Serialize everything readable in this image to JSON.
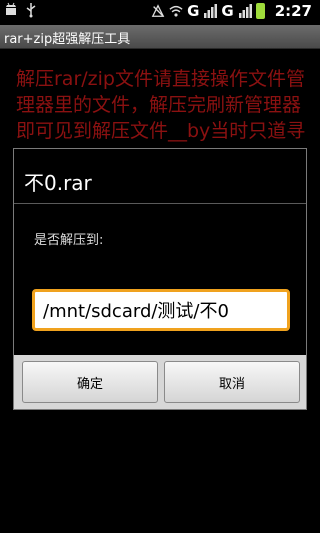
{
  "status_bar": {
    "network_letter_1": "G",
    "network_letter_2": "G",
    "time": "2:27",
    "icons": [
      "android-debug-icon",
      "usb-icon",
      "no-sim-icon",
      "wifi-icon",
      "signal-icon",
      "signal-icon",
      "battery-icon"
    ]
  },
  "app": {
    "title": "rar+zip超强解压工具"
  },
  "main": {
    "message": "解压rar/zip文件请直接操作文件管理器里的文件，解压完刷新管理器即可见到解压文件__by当时只道寻常"
  },
  "dialog": {
    "title": "不0.rar",
    "question": "是否解压到:",
    "path_value": "/mnt/sdcard/测试/不0",
    "ok_label": "确定",
    "cancel_label": "取消"
  },
  "colors": {
    "message_text": "#8b1111",
    "input_focus_border": "#f0a21e",
    "battery": "#9fdc3b"
  }
}
